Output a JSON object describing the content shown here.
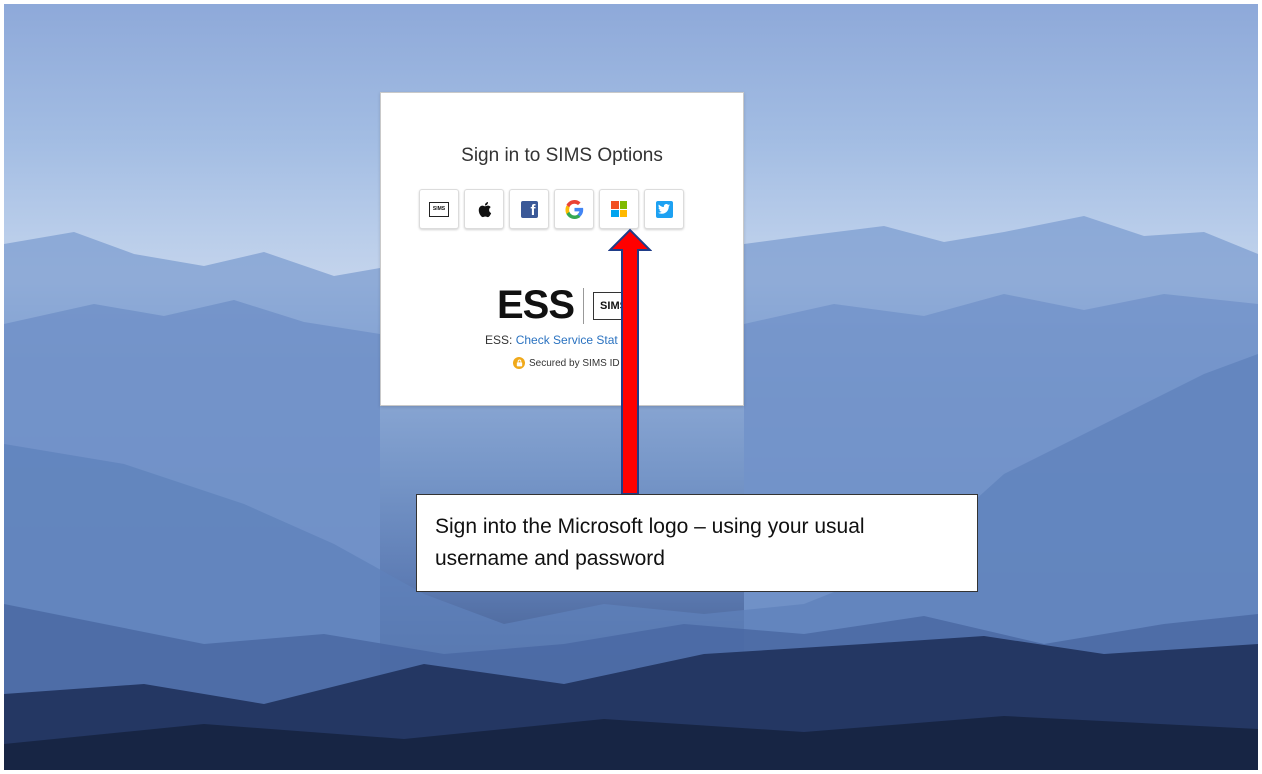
{
  "login": {
    "title": "Sign in to SIMS Options",
    "providers": [
      {
        "id": "sims",
        "label": "SIMS"
      },
      {
        "id": "apple",
        "label": "Apple"
      },
      {
        "id": "facebook",
        "label": "Facebook"
      },
      {
        "id": "google",
        "label": "Google"
      },
      {
        "id": "microsoft",
        "label": "Microsoft"
      },
      {
        "id": "twitter",
        "label": "Twitter"
      }
    ],
    "sims_mark": "SIMS",
    "brand": {
      "ess": "ESS",
      "sims": "SIMS"
    },
    "status_prefix": "ESS: ",
    "status_link": "Check Service Stat",
    "secured_text": "Secured by SIMS ID"
  },
  "annotation": {
    "text": "Sign into the Microsoft logo – using your usual username and password"
  },
  "colors": {
    "arrow_fill": "#ff0000",
    "arrow_border": "#1f3c88",
    "link": "#2a72c0",
    "facebook": "#3b5998",
    "twitter": "#1da1f2"
  }
}
